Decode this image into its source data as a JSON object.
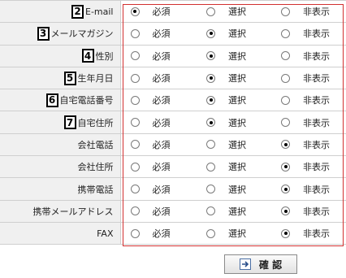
{
  "options": [
    "必須",
    "選択",
    "非表示"
  ],
  "rows": [
    {
      "badge": "2",
      "label": "E-mail",
      "selected": 0
    },
    {
      "badge": "3",
      "label": "メールマガジン",
      "selected": 1
    },
    {
      "badge": "4",
      "label": "性別",
      "selected": 1
    },
    {
      "badge": "5",
      "label": "生年月日",
      "selected": 1
    },
    {
      "badge": "6",
      "label": "自宅電話番号",
      "selected": 1
    },
    {
      "badge": "7",
      "label": "自宅住所",
      "selected": 1
    },
    {
      "badge": "",
      "label": "会社電話",
      "selected": 2
    },
    {
      "badge": "",
      "label": "会社住所",
      "selected": 2
    },
    {
      "badge": "",
      "label": "携帯電話",
      "selected": 2
    },
    {
      "badge": "",
      "label": "携帯メールアドレス",
      "selected": 2
    },
    {
      "badge": "",
      "label": "FAX",
      "selected": 2
    }
  ],
  "confirm_button": {
    "label": "確 認",
    "icon": "confirm-arrow-icon"
  },
  "colors": {
    "frame": "#d23030",
    "label_bg": "#f0f0f0"
  }
}
